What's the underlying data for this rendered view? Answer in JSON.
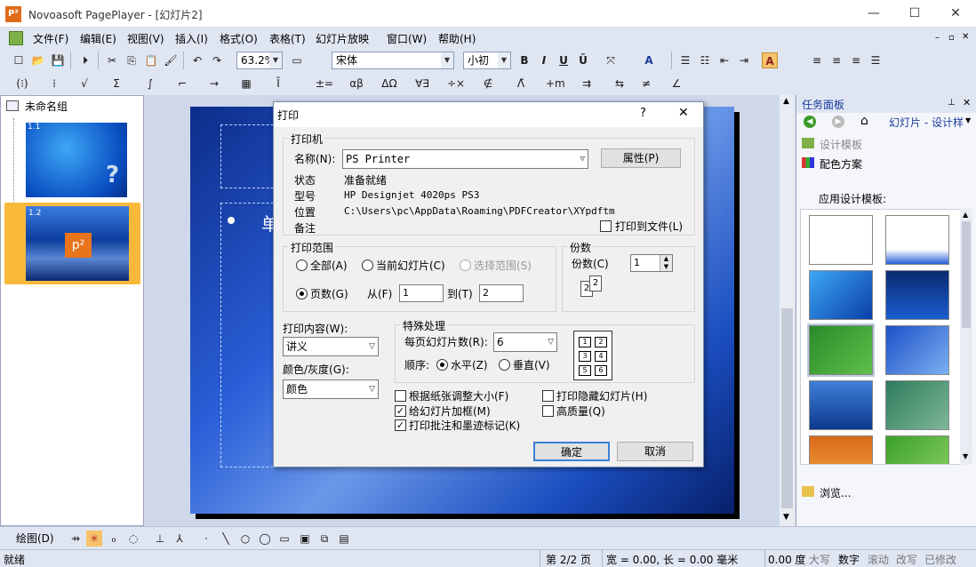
{
  "app": {
    "title": "Novoasoft PagePlayer - [幻灯片2]",
    "icon_text": "P²"
  },
  "menu": [
    "文件(F)",
    "编辑(E)",
    "视图(V)",
    "插入(I)",
    "格式(O)",
    "表格(T)",
    "幻灯片放映",
    "窗口(W)",
    "帮助(H)"
  ],
  "toolbar": {
    "zoom": "63.2%",
    "font": "宋体",
    "size": "小初"
  },
  "outline": {
    "group_label": "未命名组",
    "slides": [
      {
        "number": "1.1"
      },
      {
        "number": "1.2"
      }
    ]
  },
  "slide": {
    "partial_title": "单"
  },
  "taskpane": {
    "title": "任务面板",
    "nav_label": "幻灯片 - 设计样",
    "links": [
      "设计模板",
      "配色方案"
    ],
    "section_label": "应用设计模板:",
    "browse": "浏览..."
  },
  "dialog": {
    "title": "打印",
    "help": "?",
    "close": "✕",
    "printer": {
      "group": "打印机",
      "name_label": "名称(N):",
      "name_value": "PS Printer",
      "properties": "属性(P)",
      "status_label": "状态",
      "status_value": "准备就绪",
      "model_label": "型号",
      "model_value": "HP Designjet 4020ps PS3",
      "location_label": "位置",
      "location_value": "C:\\Users\\pc\\AppData\\Roaming\\PDFCreator\\XYpdftm",
      "comment_label": "备注",
      "print_to_file": "打印到文件(L)"
    },
    "range": {
      "group": "打印范围",
      "all": "全部(A)",
      "current": "当前幻灯片(C)",
      "selection": "选择范围(S)",
      "pages": "页数(G)",
      "from_label": "从(F)",
      "from_value": "1",
      "to_label": "到(T)",
      "to_value": "2"
    },
    "copies": {
      "group": "份数",
      "label": "份数(C)",
      "value": "1"
    },
    "content": {
      "label": "打印内容(W):",
      "value": "讲义"
    },
    "color": {
      "label": "颜色/灰度(G):",
      "value": "颜色"
    },
    "special": {
      "group": "特殊处理",
      "per_page_label": "每页幻灯片数(R):",
      "per_page_value": "6",
      "order_label": "顺序:",
      "horizontal": "水平(Z)",
      "vertical": "垂直(V)"
    },
    "options": {
      "fit": "根据纸张调整大小(F)",
      "frame": "给幻灯片加框(M)",
      "comments": "打印批注和墨迹标记(K)",
      "hidden": "打印隐藏幻灯片(H)",
      "quality": "高质量(Q)"
    },
    "ok": "确定",
    "cancel": "取消"
  },
  "drawbar": {
    "label": "绘图(D)"
  },
  "status": {
    "left": "就绪",
    "page": "第 2/2 页",
    "dims": "宽 = 0.00, 长 = 0.00 毫米",
    "num": "0.00 度",
    "caps": "大写",
    "numlock": "数字",
    "scroll": "滚动",
    "ovr": "改写",
    "sel": "已修改"
  }
}
